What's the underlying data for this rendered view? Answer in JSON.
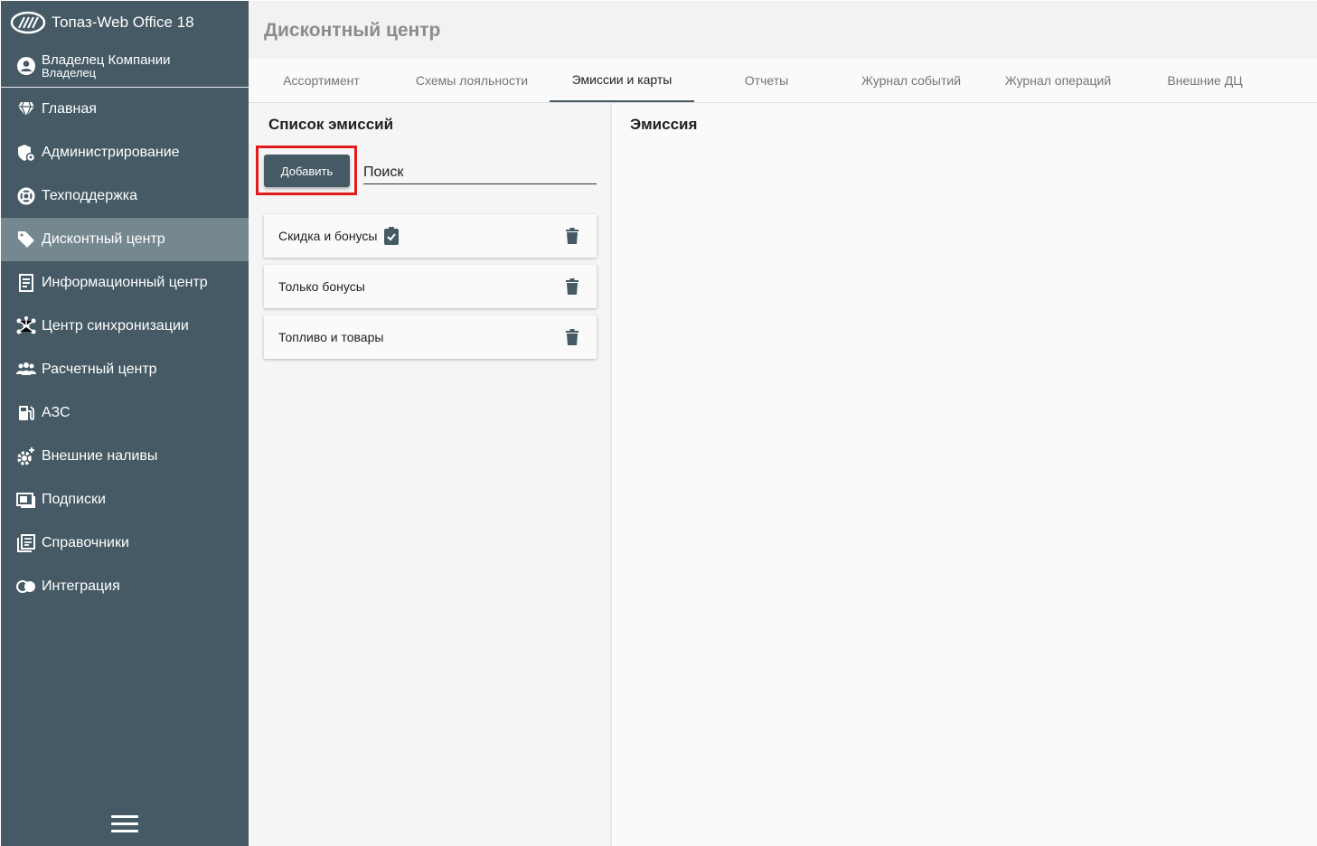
{
  "app": {
    "title": "Топаз-Web Office 18"
  },
  "user": {
    "name": "Владелец Компании",
    "role": "Владелец"
  },
  "sidebar": {
    "items": [
      {
        "label": "Главная",
        "icon": "diamond-icon",
        "active": false
      },
      {
        "label": "Администрирование",
        "icon": "admin-shield-icon",
        "active": false
      },
      {
        "label": "Техподдержка",
        "icon": "lifebuoy-icon",
        "active": false
      },
      {
        "label": "Дисконтный центр",
        "icon": "tag-icon",
        "active": true
      },
      {
        "label": "Информационный центр",
        "icon": "document-icon",
        "active": false
      },
      {
        "label": "Центр синхронизации",
        "icon": "sync-hub-icon",
        "active": false
      },
      {
        "label": "Расчетный центр",
        "icon": "users-group-icon",
        "active": false
      },
      {
        "label": "АЗС",
        "icon": "gas-station-icon",
        "active": false
      },
      {
        "label": "Внешние наливы",
        "icon": "gear-plus-icon",
        "active": false
      },
      {
        "label": "Подписки",
        "icon": "subscription-icon",
        "active": false
      },
      {
        "label": "Справочники",
        "icon": "book-list-icon",
        "active": false
      },
      {
        "label": "Интеграция",
        "icon": "overlap-circles-icon",
        "active": false
      }
    ]
  },
  "header": {
    "title": "Дисконтный центр"
  },
  "tabs": [
    {
      "label": "Ассортимент",
      "active": false
    },
    {
      "label": "Схемы лояльности",
      "active": false
    },
    {
      "label": "Эмиссии и карты",
      "active": true
    },
    {
      "label": "Отчеты",
      "active": false
    },
    {
      "label": "Журнал событий",
      "active": false
    },
    {
      "label": "Журнал операций",
      "active": false
    },
    {
      "label": "Внешние ДЦ",
      "active": false
    }
  ],
  "emission_list": {
    "title": "Список эмиссий",
    "add_label": "Добавить",
    "search_placeholder": "Поиск",
    "items": [
      {
        "label": "Скидка и бонусы",
        "has_badge": true
      },
      {
        "label": "Только бонусы",
        "has_badge": false
      },
      {
        "label": "Топливо и товары",
        "has_badge": false
      }
    ]
  },
  "emission_detail": {
    "title": "Эмиссия"
  },
  "colors": {
    "sidebar": "#455a64",
    "sidebar_active": "#758890",
    "highlight": "#e41b1b"
  }
}
